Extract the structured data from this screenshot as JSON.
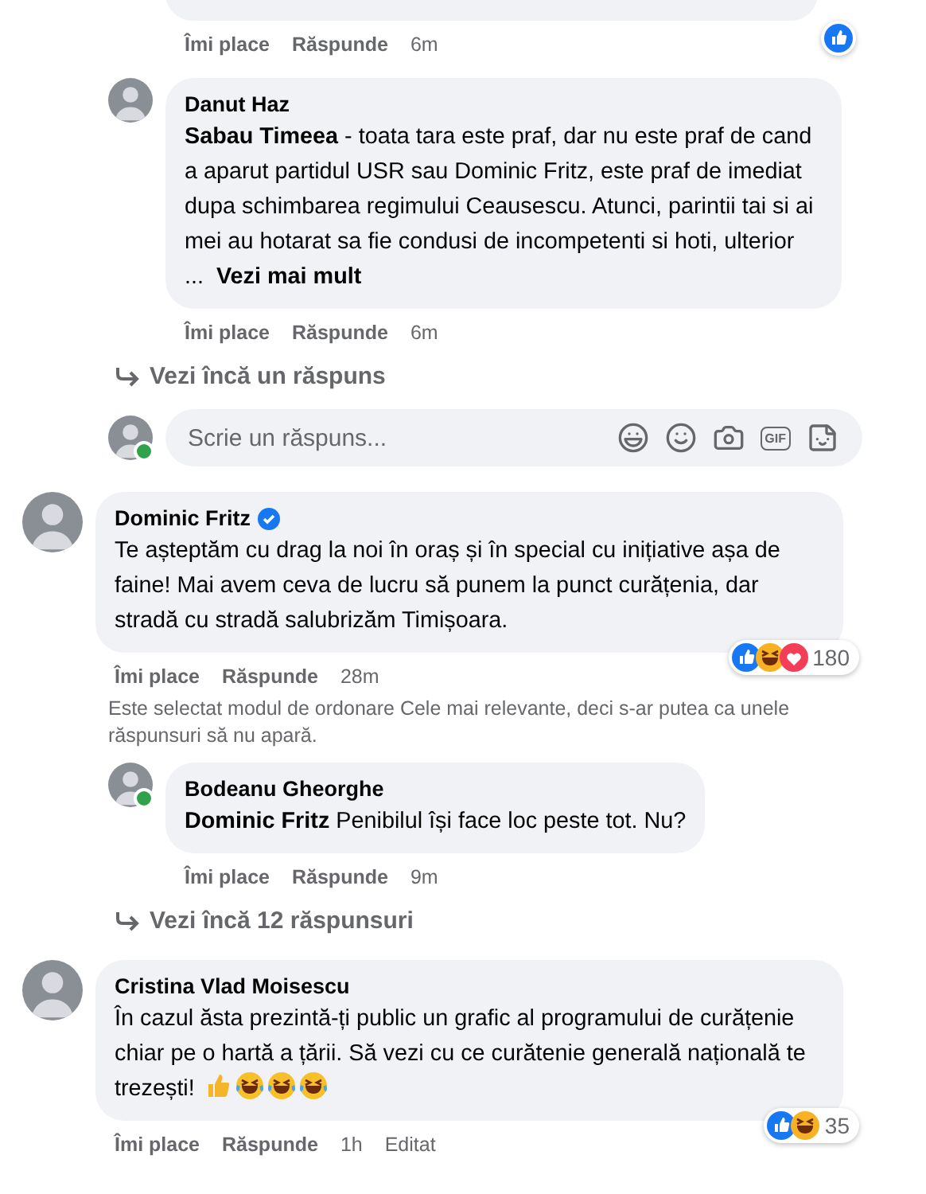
{
  "earlier_thread": {
    "replies": [
      {
        "kind": "cut",
        "reactions": [
          {
            "kind": "like"
          }
        ],
        "actions": {
          "like": "Îmi place",
          "reply": "Răspunde",
          "time": "6m"
        }
      },
      {
        "kind": "full",
        "author": "Danut Haz",
        "online": false,
        "text": "**Sabau Timeea** - toata tara este praf, dar nu este praf de cand a aparut partidul USR sau Dominic Fritz, este praf de imediat dupa schimbarea regimului Ceausescu. Atunci, parintii tai si ai mei au hotarat sa fie condusi de incompetenti si hoti, ulterior",
        "ellipsis": "...",
        "see_more": "Vezi mai mult",
        "actions": {
          "like": "Îmi place",
          "reply": "Răspunde",
          "time": "6m"
        }
      }
    ],
    "more_replies": "Vezi încă un răspuns",
    "reply_box": {
      "placeholder": "Scrie un răspuns...",
      "online": true,
      "gif_label": "GIF"
    }
  },
  "comments": [
    {
      "author": "Dominic Fritz",
      "verified": true,
      "text": "Te așteptăm cu drag la noi în oraș și în special cu inițiative așa de faine! Mai avem ceva de lucru să punem la punct curățenia, dar stradă cu stradă salubrizăm Timișoara.",
      "reactions": [
        {
          "kind": "like"
        },
        {
          "kind": "haha"
        },
        {
          "kind": "love"
        }
      ],
      "reaction_count": "180",
      "actions": {
        "like": "Îmi place",
        "reply": "Răspunde",
        "time": "28m"
      },
      "sort_note": "Este selectat modul de ordonare Cele mai relevante, deci s-ar putea ca unele răspunsuri să nu apară.",
      "replies": [
        {
          "kind": "full",
          "author": "Bodeanu Gheorghe",
          "online": true,
          "text": "**Dominic Fritz** Penibilul își face loc peste tot. Nu?",
          "actions": {
            "like": "Îmi place",
            "reply": "Răspunde",
            "time": "9m"
          }
        }
      ],
      "more_replies": "Vezi încă 12 răspunsuri"
    },
    {
      "author": "Cristina Vlad Moisescu",
      "verified": false,
      "text": "În cazul ăsta prezintă-ți public un grafic al programului de curățenie chiar pe o hartă a țării. Să vezi cu ce curătenie generală națională te trezești!",
      "emojis": [
        {
          "kind": "thumbs_up"
        },
        {
          "kind": "laughing"
        },
        {
          "kind": "laughing"
        },
        {
          "kind": "laughing"
        }
      ],
      "reactions": [
        {
          "kind": "like"
        },
        {
          "kind": "haha"
        }
      ],
      "reaction_count": "35",
      "actions": {
        "like": "Îmi place",
        "reply": "Răspunde",
        "time": "1h",
        "edited": "Editat"
      }
    }
  ]
}
